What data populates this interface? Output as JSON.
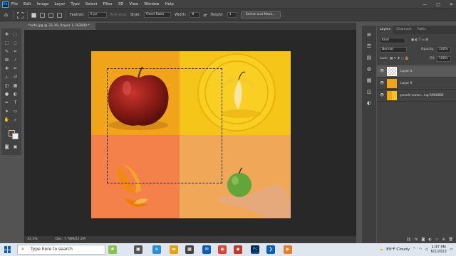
{
  "app": {
    "logo": "Ps"
  },
  "menu": [
    "File",
    "Edit",
    "Image",
    "Layer",
    "Type",
    "Select",
    "Filter",
    "3D",
    "View",
    "Window",
    "Help"
  ],
  "window_controls": {
    "minimize": "—",
    "maximize": "□",
    "close": "✕"
  },
  "options_bar": {
    "feather_label": "Feather:",
    "feather_value": "0 px",
    "antialias_label": "Anti-alias",
    "style_label": "Style:",
    "style_value": "Fixed Ratio",
    "width_label": "Width:",
    "width_value": "8",
    "height_label": "Height:",
    "height_value": "1",
    "select_mask_label": "Select and Mask..."
  },
  "document": {
    "tab_title": "fruits.jpg @ 33.3% (Layer 1, RGB/8) *",
    "zoom": "33.3%",
    "doc_size": "Doc: 7.78M/22.2M"
  },
  "colors": {
    "foreground": "#5a4626",
    "background": "#f2f0e8"
  },
  "layers_panel": {
    "tabs": [
      "Layers",
      "Channels",
      "Paths"
    ],
    "filter_kind": "Kind",
    "blend_mode": "Normal",
    "opacity_label": "Opacity:",
    "opacity_value": "100%",
    "lock_label": "Lock:",
    "fill_label": "Fill:",
    "fill_value": "100%",
    "layers": [
      {
        "name": "Layer 1",
        "selected": true,
        "eye": "👁"
      },
      {
        "name": "Layer 0",
        "selected": false,
        "eye": "👁"
      },
      {
        "name": "pexels-vanes...ing-5960685",
        "selected": false,
        "eye": "👁"
      }
    ]
  },
  "taskbar": {
    "search_placeholder": "Type here to search",
    "weather": "89°F  Cloudy",
    "time": "1:37 PM",
    "date": "6/2/2022"
  }
}
